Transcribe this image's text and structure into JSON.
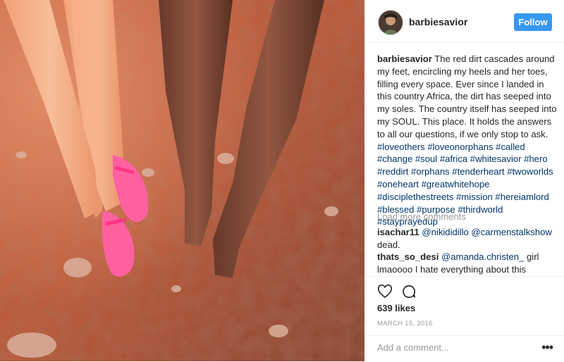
{
  "post": {
    "username": "barbiesavior",
    "follow_label": "Follow",
    "caption_username": "barbiesavior",
    "caption_text": " The red dirt cascades around my feet, encircling my heels and her toes, filling every space.  Ever since I landed in this country Africa, the dirt has seeped into my soles. The country itself has seeped into my SOUL. This place. It holds the answers to all our questions, if we only stop to ask. ",
    "hashtags": [
      "#loveothers",
      "#loveonorphans",
      "#called",
      "#change",
      "#soul",
      "#africa",
      "#whitesavior",
      "#hero",
      "#reddirt",
      "#orphans",
      "#tenderheart",
      "#twoworlds",
      "#oneheart",
      "#greatwhitehope",
      "#disciplethestreets",
      "#mission",
      "#hereiamlord",
      "#blessed",
      "#purpose",
      "#thirdworld",
      "#stayprayedup"
    ],
    "load_more": "Load more comments",
    "comments": [
      {
        "username": "isachar11",
        "mentions": "@nikididillo @carmenstalkshow",
        "text": "dead."
      },
      {
        "username": "thats_so_desi",
        "mentions": "@amanda.christen_",
        "text": " girl lmaoooo I hate everything about this"
      }
    ],
    "likes": "639 likes",
    "date": "MARCH 15, 2016",
    "add_comment_placeholder": "Add a comment...",
    "more_label": "•••"
  },
  "icons": {
    "avatar": "profile-avatar",
    "like": "heart-outline-icon",
    "comment": "speech-bubble-icon",
    "more": "more-options-icon"
  },
  "colors": {
    "follow_button": "#3897f0",
    "hashtag": "#003569",
    "muted": "#999999"
  }
}
